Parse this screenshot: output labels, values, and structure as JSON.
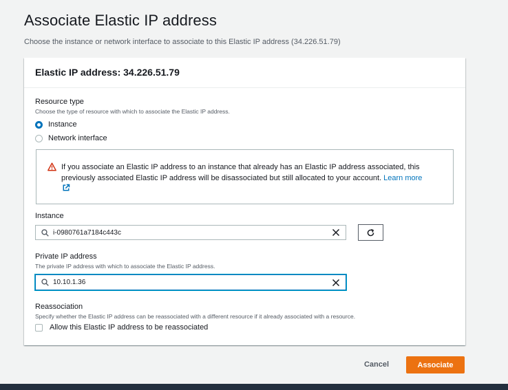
{
  "page": {
    "title": "Associate Elastic IP address",
    "description": "Choose the instance or network interface to associate to this Elastic IP address (34.226.51.79)"
  },
  "card": {
    "header": "Elastic IP address: 34.226.51.79"
  },
  "resource_type": {
    "label": "Resource type",
    "description": "Choose the type of resource with which to associate the Elastic IP address.",
    "options": [
      {
        "label": "Instance",
        "selected": true
      },
      {
        "label": "Network interface",
        "selected": false
      }
    ]
  },
  "alert": {
    "icon": "warning-icon",
    "message": "If you associate an Elastic IP address to an instance that already has an Elastic IP address associated, this previously associated Elastic IP address will be disassociated but still allocated to your account.",
    "link_label": "Learn more",
    "link_icon": "external-link-icon"
  },
  "instance": {
    "label": "Instance",
    "value": "i-0980761a7184c443c"
  },
  "private_ip": {
    "label": "Private IP address",
    "description": "The private IP address with which to associate the Elastic IP address.",
    "value": "10.10.1.36"
  },
  "reassociation": {
    "label": "Reassociation",
    "description": "Specify whether the Elastic IP address can be reassociated with a different resource if it already associated with a resource.",
    "checkbox_label": "Allow this Elastic IP address to be reassociated",
    "checked": false
  },
  "actions": {
    "cancel": "Cancel",
    "submit": "Associate"
  },
  "colors": {
    "primary": "#ec7211",
    "link": "#0073bb",
    "warning": "#d13212",
    "bottom_bar": "#232f3e"
  }
}
